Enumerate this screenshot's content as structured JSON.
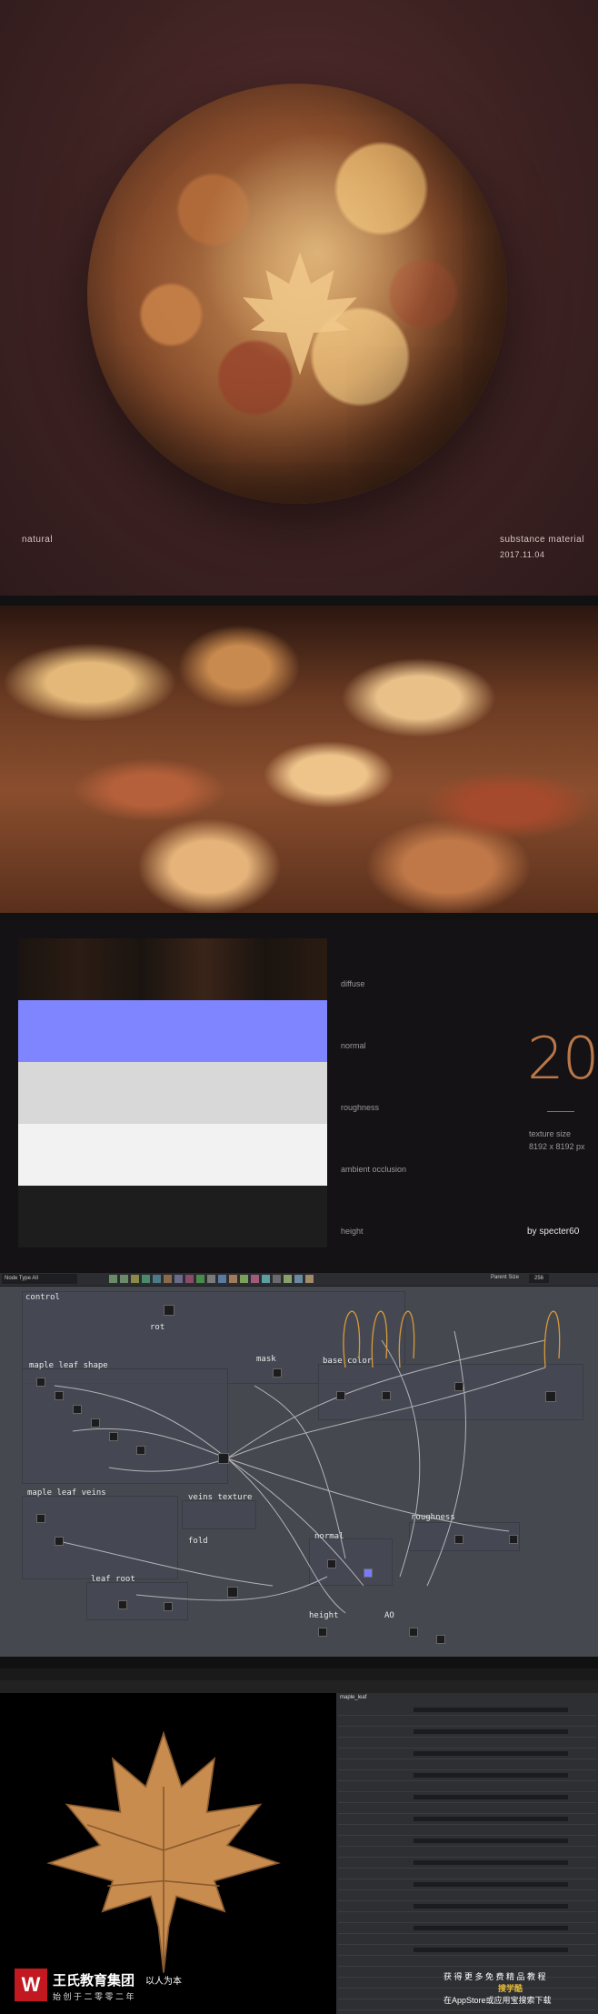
{
  "section1": {
    "tag_left": "natural",
    "tag_right": "substance material",
    "date": "2017.11.04"
  },
  "section3": {
    "maps": [
      "diffuse",
      "normal",
      "roughness",
      "ambient occlusion",
      "height"
    ],
    "number": "20",
    "texture_size_label": "texture size",
    "texture_size": "8192 x 8192 px",
    "credit": "by specter60"
  },
  "graph": {
    "dropdown": "Node Type All",
    "parent_label": "Parent Size",
    "parent_value": "256",
    "frames": [
      "control",
      "rot",
      "mask",
      "base color",
      "maple leaf shape",
      "maple leaf veins",
      "veins texture",
      "fold",
      "leaf root",
      "normal",
      "roughness",
      "height",
      "AO"
    ]
  },
  "bottom": {
    "panel_title": "maple_leaf",
    "watermark_company": "王氏教育集团",
    "watermark_slogan": "以人为本",
    "watermark_sub": "始 创 于 二 零 零 二 年",
    "promo_line1": "获 得 更 多 免 费 精 品 教 程",
    "promo_app": "搜学酷",
    "promo_line2": "在AppStore或应用宝搜索下载"
  },
  "colors": {
    "accent_orange": "#b9784a",
    "normal_map": "#7f84ff",
    "watermark_red": "#c2181f"
  }
}
